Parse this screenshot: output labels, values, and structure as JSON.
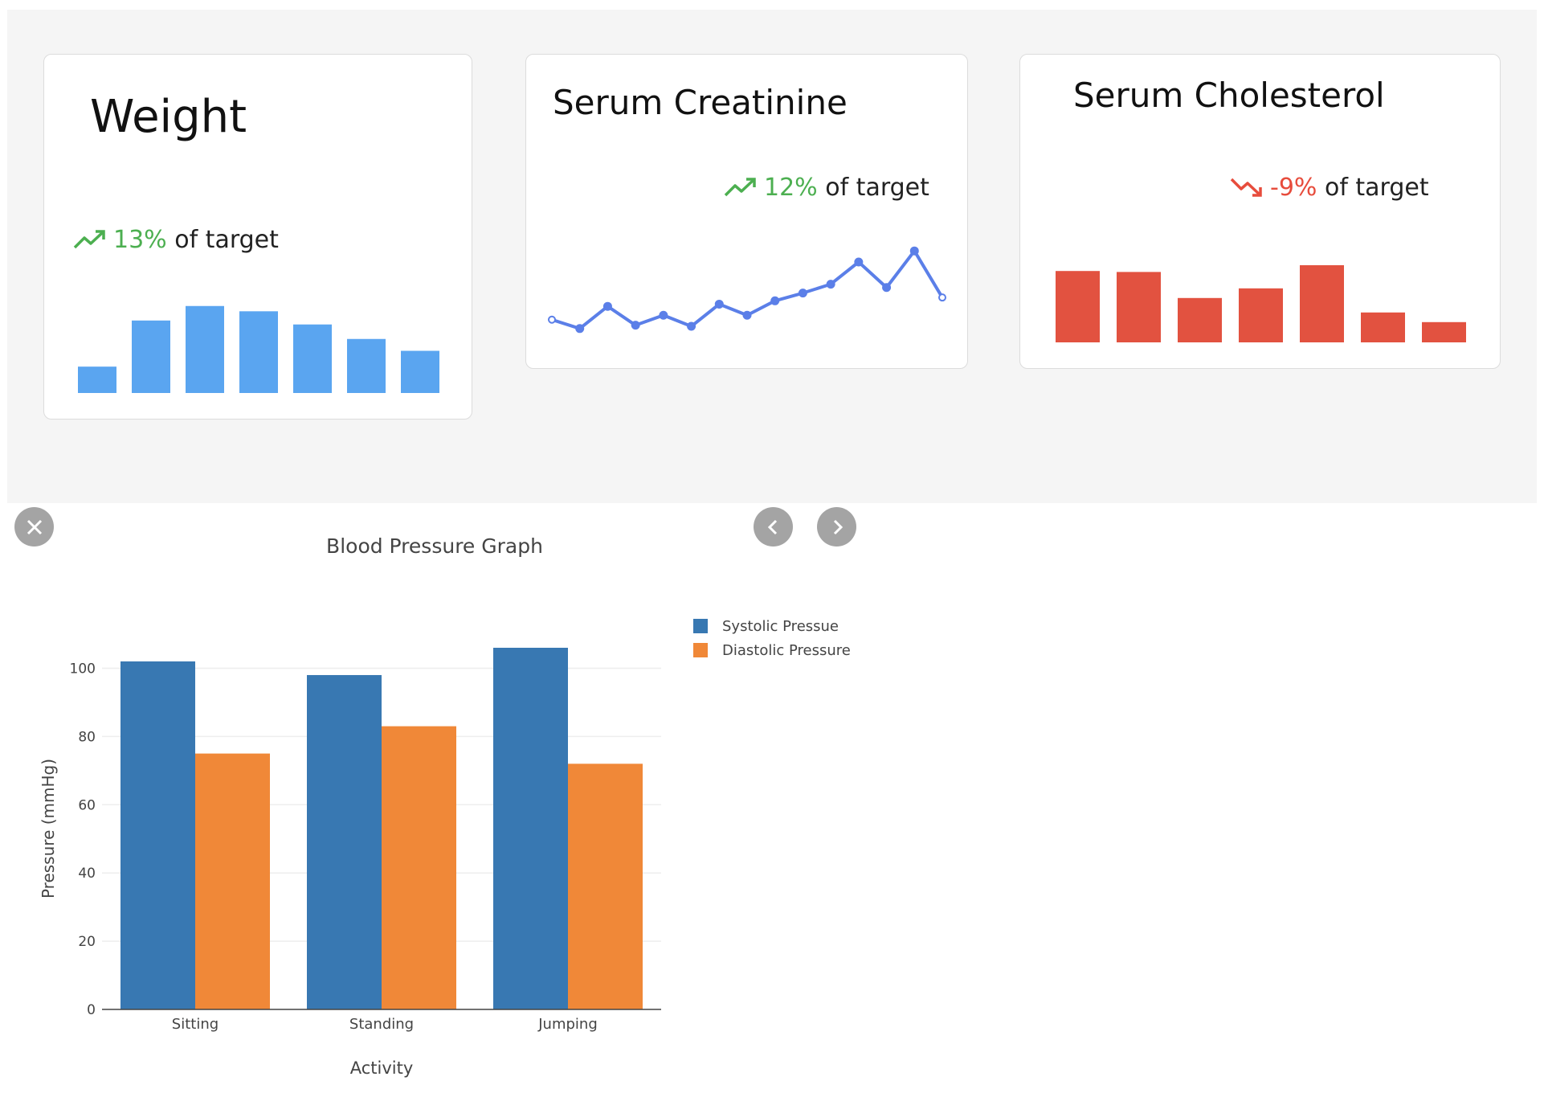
{
  "cards": {
    "weight": {
      "title": "Weight",
      "trend": "up",
      "percent": "13%",
      "suffix": " of target",
      "icon": "trending-up-icon",
      "color": "#5aa5f0",
      "bars": [
        0.2,
        0.55,
        0.66,
        0.62,
        0.52,
        0.41,
        0.32
      ]
    },
    "creatinine": {
      "title": "Serum Creatinine",
      "trend": "up",
      "percent": "12%",
      "suffix": " of target",
      "icon": "trending-up-icon",
      "color": "#5b7fe8",
      "points": [
        0.48,
        0.4,
        0.6,
        0.43,
        0.52,
        0.42,
        0.62,
        0.52,
        0.65,
        0.72,
        0.8,
        1.0,
        0.77,
        1.1,
        0.68
      ]
    },
    "cholesterol": {
      "title": "Serum Cholesterol",
      "trend": "down",
      "percent": "-9%",
      "suffix": " of target",
      "icon": "trending-down-icon",
      "color": "#e25240",
      "bars": [
        0.74,
        0.73,
        0.46,
        0.56,
        0.8,
        0.31,
        0.21
      ]
    }
  },
  "bp_panel": {
    "close_icon": "close-icon",
    "prev_icon": "chevron-left-icon",
    "next_icon": "chevron-right-icon"
  },
  "chart_data": {
    "type": "bar",
    "title": "Blood Pressure Graph",
    "xlabel": "Activity",
    "ylabel": "Pressure (mmHg)",
    "categories": [
      "Sitting",
      "Standing",
      "Jumping"
    ],
    "series": [
      {
        "name": "Systolic Pressue",
        "values": [
          102,
          98,
          106
        ],
        "color": "#3878b2"
      },
      {
        "name": "Diastolic Pressure",
        "values": [
          75,
          83,
          72
        ],
        "color": "#f08838"
      }
    ],
    "ylim": [
      0,
      106
    ],
    "yticks": [
      0,
      20,
      40,
      60,
      80,
      100
    ],
    "grid": true,
    "legend": "top-right"
  }
}
